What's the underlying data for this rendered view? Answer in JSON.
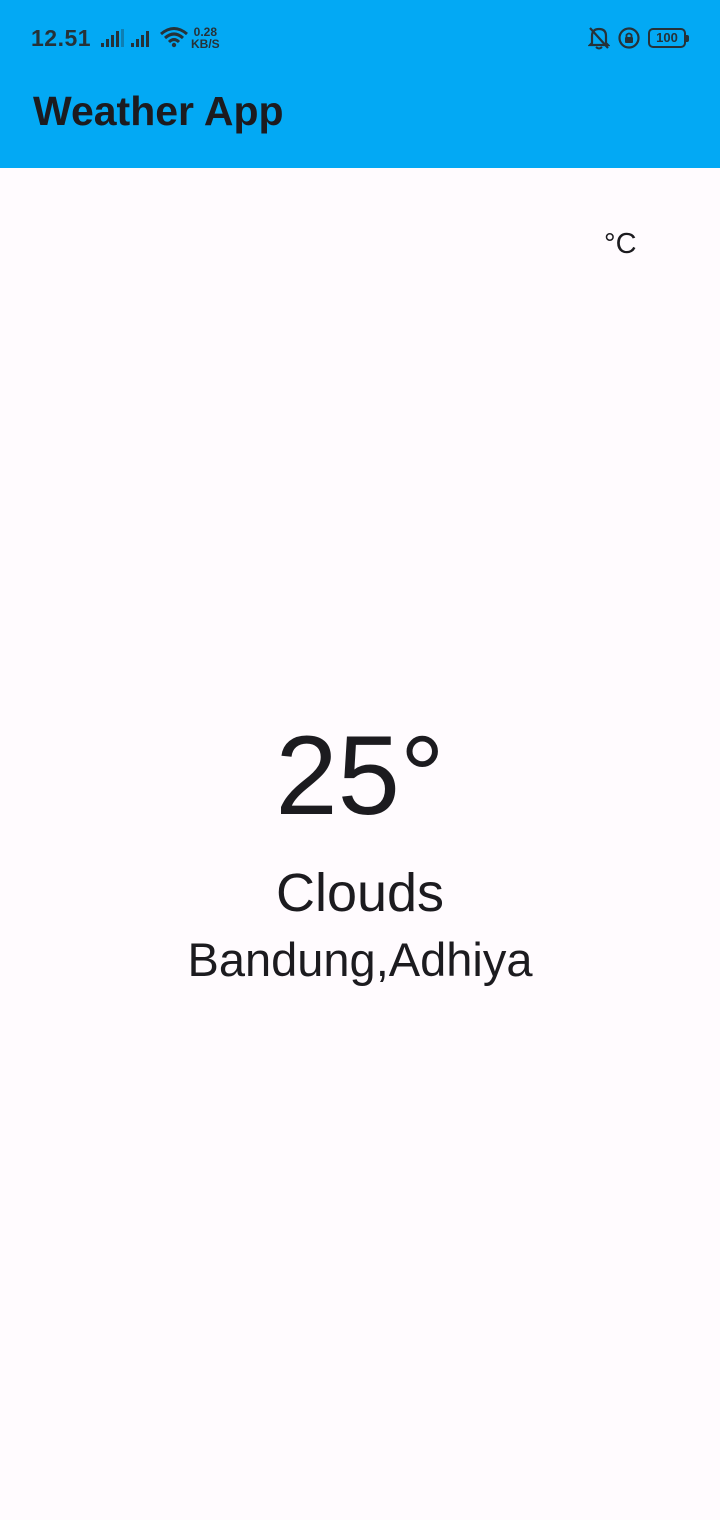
{
  "status_bar": {
    "time": "12.51",
    "net_speed_value": "0.28",
    "net_speed_unit": "KB/S",
    "battery": "100",
    "icons": [
      "signal-icon",
      "signal-icon",
      "wifi-icon",
      "bell-off-icon",
      "rotation-lock-icon",
      "battery-icon"
    ]
  },
  "appbar": {
    "title": "Weather App",
    "color": "#03A9F4"
  },
  "weather": {
    "unit_label": "°C",
    "temperature": "25°",
    "condition": "Clouds",
    "location": "Bandung,Adhiya"
  }
}
